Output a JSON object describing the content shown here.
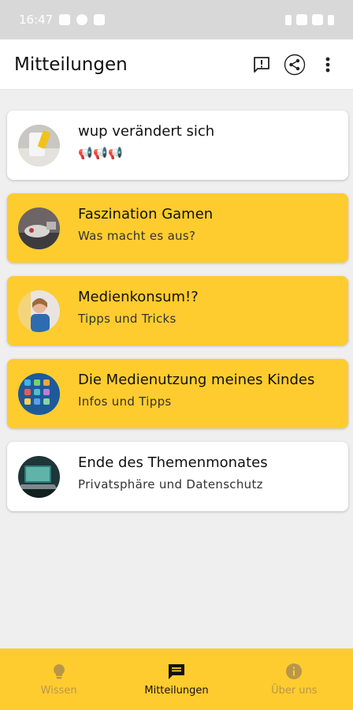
{
  "status_bar": {
    "time": "16:47"
  },
  "header": {
    "title": "Mitteilungen"
  },
  "notifications": [
    {
      "title": "wup verändert sich",
      "subtitle": "📢📢📢",
      "style": "white"
    },
    {
      "title": "Faszination Gamen",
      "subtitle": "Was macht es aus?",
      "style": "yellow"
    },
    {
      "title": "Medienkonsum!?",
      "subtitle": "Tipps und Tricks",
      "style": "yellow"
    },
    {
      "title": "Die Medienutzung meines Kindes",
      "subtitle": "Infos und Tipps",
      "style": "yellow"
    },
    {
      "title": "Ende des Themenmonates",
      "subtitle": "Privatsphäre und Datenschutz",
      "style": "white"
    }
  ],
  "bottom_nav": [
    {
      "label": "Wissen",
      "icon": "lightbulb-icon",
      "active": false
    },
    {
      "label": "Mitteilungen",
      "icon": "message-icon",
      "active": true
    },
    {
      "label": "Über uns",
      "icon": "info-icon",
      "active": false
    }
  ],
  "colors": {
    "accent": "#ffcc2f",
    "background": "#efefef",
    "card_white": "#ffffff"
  }
}
